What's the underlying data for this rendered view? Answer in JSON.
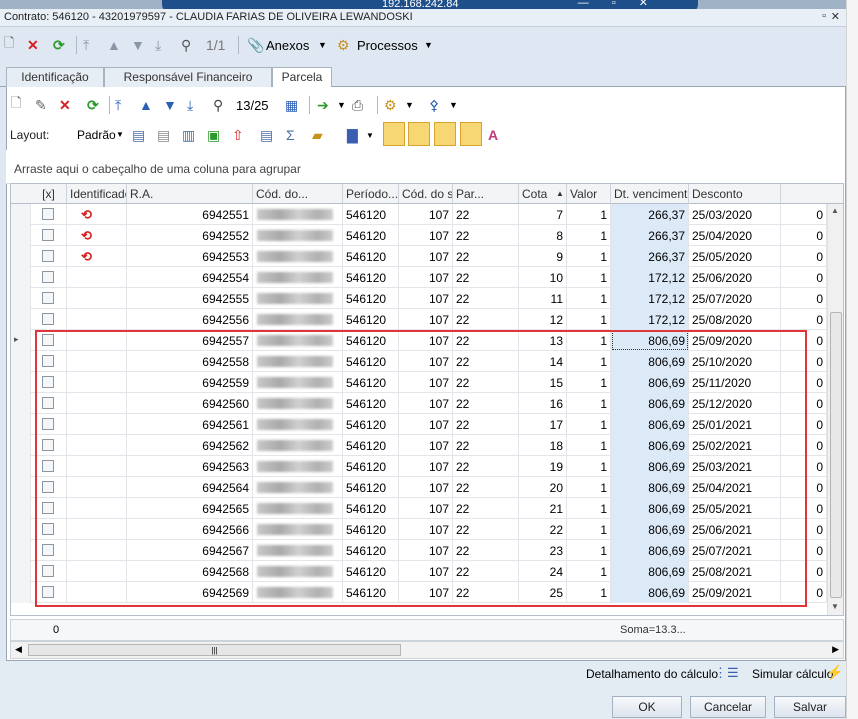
{
  "remote": {
    "ip": "192.168.242.84"
  },
  "window": {
    "title": "Contrato: 546120 - 43201979597 - CLAUDIA FARIAS DE OLIVEIRA LEWANDOSKI"
  },
  "toolbar1": {
    "nav_count": "1/1",
    "anexos": "Anexos",
    "processos": "Processos"
  },
  "tabs": [
    "Identificação",
    "Responsável Financeiro",
    "Parcela"
  ],
  "toolbar2": {
    "nav_count": "13/25"
  },
  "toolbar3": {
    "layout_label": "Layout:",
    "layout_value": "Padrão"
  },
  "group_hint": "Arraste aqui o cabeçalho de uma coluna para agrupar",
  "columns": [
    "[x]",
    "",
    "Identificador da parcela",
    "R.A.",
    "Cód. do...",
    "Período...",
    "Cód. do s...",
    "Par...",
    "Cota",
    "Valor",
    "Dt. vencimento",
    "Desconto"
  ],
  "rows": [
    {
      "id": "6942551",
      "cod": "546120",
      "periodo": "107",
      "cods": "22",
      "par": "7",
      "cota": "1",
      "valor": "266,37",
      "venc": "25/03/2020",
      "desc": "0",
      "flag": true
    },
    {
      "id": "6942552",
      "cod": "546120",
      "periodo": "107",
      "cods": "22",
      "par": "8",
      "cota": "1",
      "valor": "266,37",
      "venc": "25/04/2020",
      "desc": "0",
      "flag": true
    },
    {
      "id": "6942553",
      "cod": "546120",
      "periodo": "107",
      "cods": "22",
      "par": "9",
      "cota": "1",
      "valor": "266,37",
      "venc": "25/05/2020",
      "desc": "0",
      "flag": true
    },
    {
      "id": "6942554",
      "cod": "546120",
      "periodo": "107",
      "cods": "22",
      "par": "10",
      "cota": "1",
      "valor": "172,12",
      "venc": "25/06/2020",
      "desc": "0",
      "flag": false
    },
    {
      "id": "6942555",
      "cod": "546120",
      "periodo": "107",
      "cods": "22",
      "par": "11",
      "cota": "1",
      "valor": "172,12",
      "venc": "25/07/2020",
      "desc": "0",
      "flag": false
    },
    {
      "id": "6942556",
      "cod": "546120",
      "periodo": "107",
      "cods": "22",
      "par": "12",
      "cota": "1",
      "valor": "172,12",
      "venc": "25/08/2020",
      "desc": "0",
      "flag": false
    },
    {
      "id": "6942557",
      "cod": "546120",
      "periodo": "107",
      "cods": "22",
      "par": "13",
      "cota": "1",
      "valor": "806,69",
      "venc": "25/09/2020",
      "desc": "0",
      "flag": false,
      "current": true
    },
    {
      "id": "6942558",
      "cod": "546120",
      "periodo": "107",
      "cods": "22",
      "par": "14",
      "cota": "1",
      "valor": "806,69",
      "venc": "25/10/2020",
      "desc": "0",
      "flag": false
    },
    {
      "id": "6942559",
      "cod": "546120",
      "periodo": "107",
      "cods": "22",
      "par": "15",
      "cota": "1",
      "valor": "806,69",
      "venc": "25/11/2020",
      "desc": "0",
      "flag": false
    },
    {
      "id": "6942560",
      "cod": "546120",
      "periodo": "107",
      "cods": "22",
      "par": "16",
      "cota": "1",
      "valor": "806,69",
      "venc": "25/12/2020",
      "desc": "0",
      "flag": false
    },
    {
      "id": "6942561",
      "cod": "546120",
      "periodo": "107",
      "cods": "22",
      "par": "17",
      "cota": "1",
      "valor": "806,69",
      "venc": "25/01/2021",
      "desc": "0",
      "flag": false
    },
    {
      "id": "6942562",
      "cod": "546120",
      "periodo": "107",
      "cods": "22",
      "par": "18",
      "cota": "1",
      "valor": "806,69",
      "venc": "25/02/2021",
      "desc": "0",
      "flag": false
    },
    {
      "id": "6942563",
      "cod": "546120",
      "periodo": "107",
      "cods": "22",
      "par": "19",
      "cota": "1",
      "valor": "806,69",
      "venc": "25/03/2021",
      "desc": "0",
      "flag": false
    },
    {
      "id": "6942564",
      "cod": "546120",
      "periodo": "107",
      "cods": "22",
      "par": "20",
      "cota": "1",
      "valor": "806,69",
      "venc": "25/04/2021",
      "desc": "0",
      "flag": false
    },
    {
      "id": "6942565",
      "cod": "546120",
      "periodo": "107",
      "cods": "22",
      "par": "21",
      "cota": "1",
      "valor": "806,69",
      "venc": "25/05/2021",
      "desc": "0",
      "flag": false
    },
    {
      "id": "6942566",
      "cod": "546120",
      "periodo": "107",
      "cods": "22",
      "par": "22",
      "cota": "1",
      "valor": "806,69",
      "venc": "25/06/2021",
      "desc": "0",
      "flag": false
    },
    {
      "id": "6942567",
      "cod": "546120",
      "periodo": "107",
      "cods": "22",
      "par": "23",
      "cota": "1",
      "valor": "806,69",
      "venc": "25/07/2021",
      "desc": "0",
      "flag": false
    },
    {
      "id": "6942568",
      "cod": "546120",
      "periodo": "107",
      "cods": "22",
      "par": "24",
      "cota": "1",
      "valor": "806,69",
      "venc": "25/08/2021",
      "desc": "0",
      "flag": false
    },
    {
      "id": "6942569",
      "cod": "546120",
      "periodo": "107",
      "cods": "22",
      "par": "25",
      "cota": "1",
      "valor": "806,69",
      "venc": "25/09/2021",
      "desc": "0",
      "flag": false
    }
  ],
  "footer": {
    "count": "0",
    "soma": "Soma=13.3..."
  },
  "bottom": {
    "detalhamento": "Detalhamento do cálculo",
    "simular": "Simular cálculo",
    "ok": "OK",
    "cancelar": "Cancelar",
    "salvar": "Salvar"
  },
  "colors": {
    "accent": "#1f4f8a",
    "highlight_box": "#e0353b",
    "valor_bg": "#dce9f7",
    "tab_bg": "#e7edf4"
  }
}
